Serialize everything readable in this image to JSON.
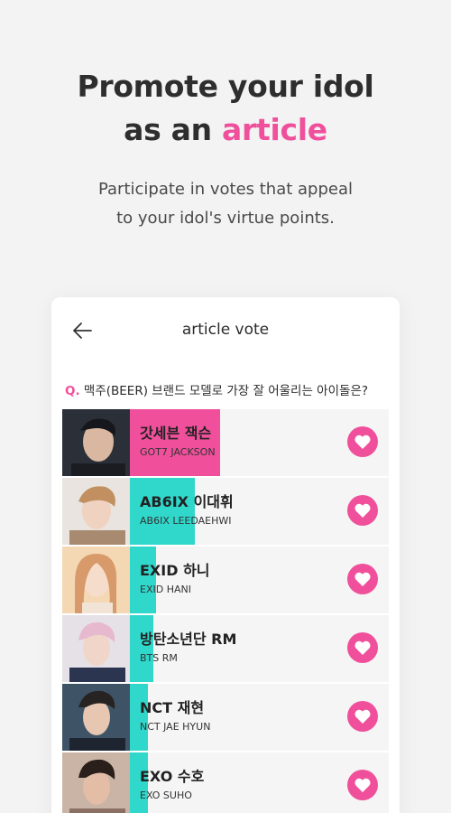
{
  "headline": {
    "line1": "Promote your idol",
    "line2_prefix": "as an ",
    "line2_accent": "article"
  },
  "subline": {
    "line1": "Participate in votes that appeal",
    "line2": "to your idol's virtue points."
  },
  "card": {
    "title": "article vote",
    "back_icon": "arrow-left-icon",
    "question_prefix": "Q.",
    "question_text": " 맥주(BEER) 브랜드 모델로 가장 잘 어울리는 아이돌은?"
  },
  "colors": {
    "accent_pink": "#f0509b",
    "bar_pink": "#f0509b",
    "bar_teal": "#30d8cc"
  },
  "candidates": [
    {
      "name_kr": "갓세븐 잭슨",
      "name_en": "GOT7 JACKSON",
      "bar_fraction": 0.35,
      "bar_color": "#f0509b"
    },
    {
      "name_kr": "AB6IX 이대휘",
      "name_en": "AB6IX LEEDAEHWI",
      "bar_fraction": 0.25,
      "bar_color": "#30d8cc"
    },
    {
      "name_kr": "EXID 하니",
      "name_en": "EXID HANI",
      "bar_fraction": 0.1,
      "bar_color": "#30d8cc"
    },
    {
      "name_kr": "방탄소년단 RM",
      "name_en": "BTS RM",
      "bar_fraction": 0.09,
      "bar_color": "#30d8cc"
    },
    {
      "name_kr": "NCT 재현",
      "name_en": "NCT JAE HYUN",
      "bar_fraction": 0.07,
      "bar_color": "#30d8cc"
    },
    {
      "name_kr": "EXO 수호",
      "name_en": "EXO SUHO",
      "bar_fraction": 0.07,
      "bar_color": "#30d8cc"
    }
  ],
  "heart_icon": "heart-icon"
}
